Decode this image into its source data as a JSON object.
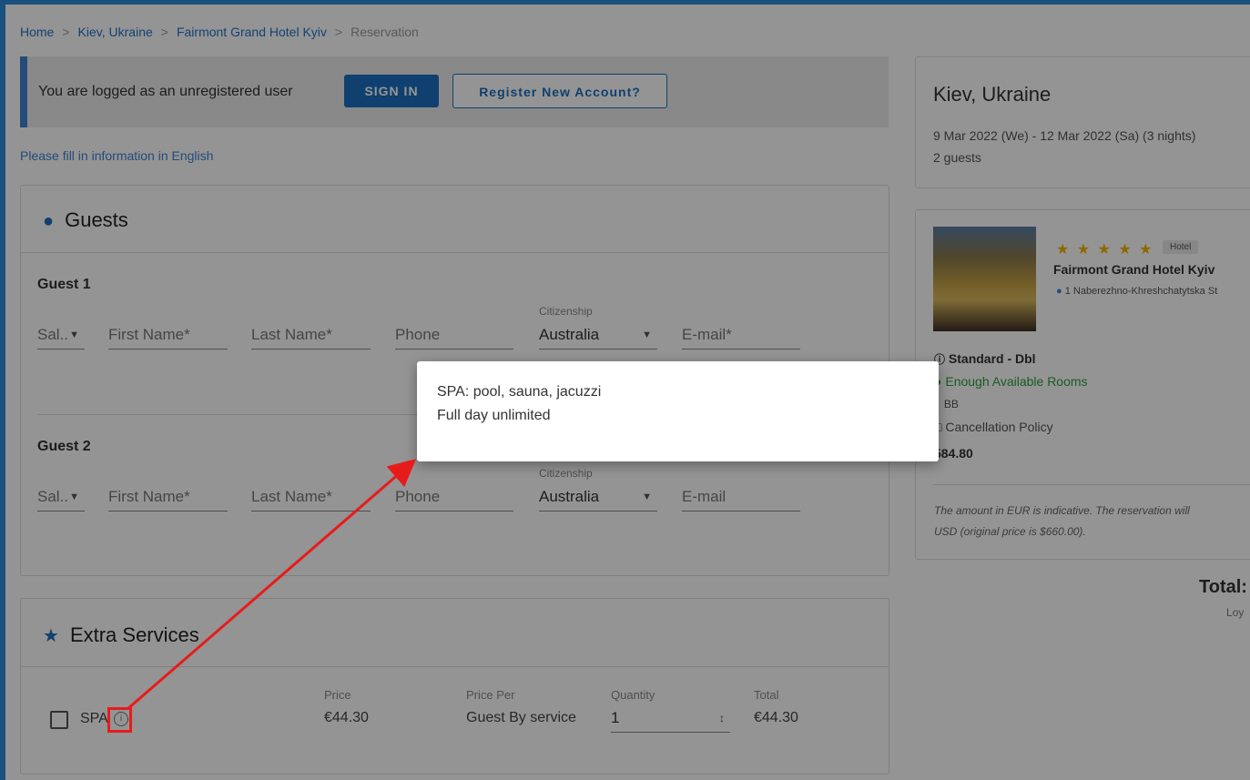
{
  "breadcrumb": {
    "home": "Home",
    "city": "Kiev, Ukraine",
    "hotel": "Fairmont Grand Hotel Kyiv",
    "current": "Reservation",
    "separator": ">"
  },
  "banner": {
    "text": "You are logged as an unregistered user",
    "sign_in": "SIGN IN",
    "register": "Register New Account?"
  },
  "fill_note": "Please fill in information in English",
  "guests": {
    "title": "Guests",
    "icon": "person-icon",
    "list": [
      {
        "label": "Guest 1",
        "salutation": "Sal..",
        "first_name_placeholder": "First Name*",
        "last_name_placeholder": "Last Name*",
        "phone_placeholder": "Phone",
        "citizenship_caption": "Citizenship",
        "citizenship_value": "Australia",
        "email_placeholder": "E-mail*"
      },
      {
        "label": "Guest 2",
        "salutation": "Sal..",
        "first_name_placeholder": "First Name*",
        "last_name_placeholder": "Last Name*",
        "phone_placeholder": "Phone",
        "citizenship_caption": "Citizenship",
        "citizenship_value": "Australia",
        "email_placeholder": "E-mail"
      }
    ]
  },
  "extras": {
    "title": "Extra Services",
    "icon": "star-icon",
    "headers": {
      "price": "Price",
      "price_per": "Price Per",
      "quantity": "Quantity",
      "total": "Total"
    },
    "row": {
      "name": "SPA",
      "price": "€44.30",
      "price_per": "Guest By service",
      "quantity": "1",
      "total": "€44.30"
    }
  },
  "summary": {
    "city": "Kiev, Ukraine",
    "dates": "9 Mar 2022 (We) - 12 Mar 2022 (Sa) (3 nights)",
    "guests": "2 guests"
  },
  "hotel": {
    "stars": "★ ★ ★ ★ ★",
    "badge": "Hotel",
    "name": "Fairmont Grand Hotel Kyiv",
    "address": "1 Naberezhno-Khreshchatytska St",
    "room": "Standard - Dbl",
    "availability": "Enough Available Rooms",
    "board": "BB",
    "cancellation": "Cancellation Policy",
    "price": "584.80",
    "disclaimer_1": "The amount in EUR is indicative. The reservation will",
    "disclaimer_2": "USD (original price is $660.00)."
  },
  "totals": {
    "label": "Total:",
    "sub": "Loy"
  },
  "popup": {
    "line1": "SPA: pool, sauna, jacuzzi",
    "line2": "Full day unlimited"
  },
  "colors": {
    "accent": "#1a6fbf",
    "annotation": "#e81b1b",
    "available": "#2e9e3b",
    "star": "#f5b301"
  }
}
